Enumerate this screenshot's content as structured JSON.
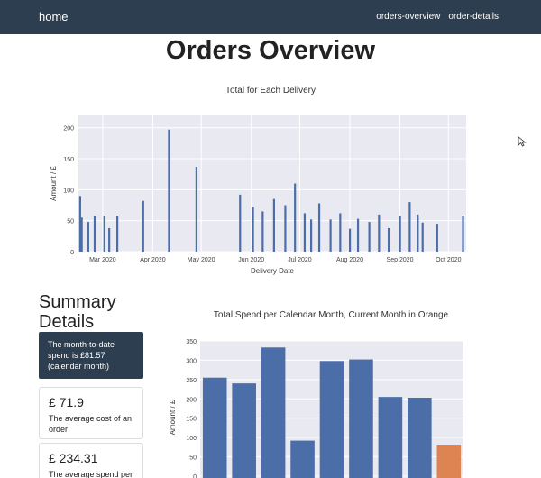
{
  "navbar": {
    "brand": "home",
    "links": [
      "orders-overview",
      "order-details"
    ]
  },
  "page_title": "Orders Overview",
  "summary": {
    "heading": "Summary Details",
    "highlight": "The month-to-date spend is £81.57 (calendar month)",
    "cards": [
      {
        "value": "£ 71.9",
        "label": "The average cost of an order"
      },
      {
        "value": "£ 234.31",
        "label": "The average spend per"
      }
    ]
  },
  "colors": {
    "navbar": "#2c3e50",
    "bar": "#4c6ea8",
    "current_month_bar": "#dd8452",
    "plot_background": "#e9e9f2"
  },
  "chart_data": [
    {
      "type": "bar",
      "title": "Total for Each Delivery",
      "xlabel": "Delivery Date",
      "ylabel": "Amount / £",
      "ylim": [
        0,
        220
      ],
      "yticks": [
        0,
        50,
        100,
        150,
        200
      ],
      "xticks": [
        "Mar 2020",
        "Apr 2020",
        "May 2020",
        "Jun 2020",
        "Jul 2020",
        "Aug 2020",
        "Sep 2020",
        "Oct 2020"
      ],
      "x_range": [
        "2020-02-15",
        "2020-10-12"
      ],
      "grid": true,
      "x": [
        "2020-02-16",
        "2020-02-17",
        "2020-02-21",
        "2020-02-25",
        "2020-03-02",
        "2020-03-05",
        "2020-03-10",
        "2020-03-26",
        "2020-04-11",
        "2020-04-28",
        "2020-05-25",
        "2020-06-02",
        "2020-06-08",
        "2020-06-15",
        "2020-06-22",
        "2020-06-28",
        "2020-07-04",
        "2020-07-08",
        "2020-07-13",
        "2020-07-20",
        "2020-07-26",
        "2020-08-01",
        "2020-08-06",
        "2020-08-13",
        "2020-08-19",
        "2020-08-25",
        "2020-09-01",
        "2020-09-07",
        "2020-09-12",
        "2020-09-15",
        "2020-09-24",
        "2020-10-10"
      ],
      "values": [
        90,
        55,
        48,
        58,
        58,
        38,
        58,
        82,
        197,
        137,
        92,
        72,
        65,
        85,
        75,
        110,
        62,
        52,
        78,
        52,
        62,
        37,
        53,
        48,
        60,
        38,
        57,
        80,
        60,
        47,
        45,
        58
      ]
    },
    {
      "type": "bar",
      "title": "Total Spend per Calendar Month, Current Month in Orange",
      "ylabel": "Amount / £",
      "ylim": [
        0,
        350
      ],
      "yticks": [
        0,
        50,
        100,
        150,
        200,
        250,
        300,
        350
      ],
      "grid": true,
      "values": [
        255,
        240,
        333,
        92,
        298,
        302,
        205,
        203,
        81.57
      ],
      "highlight_last": true
    }
  ]
}
